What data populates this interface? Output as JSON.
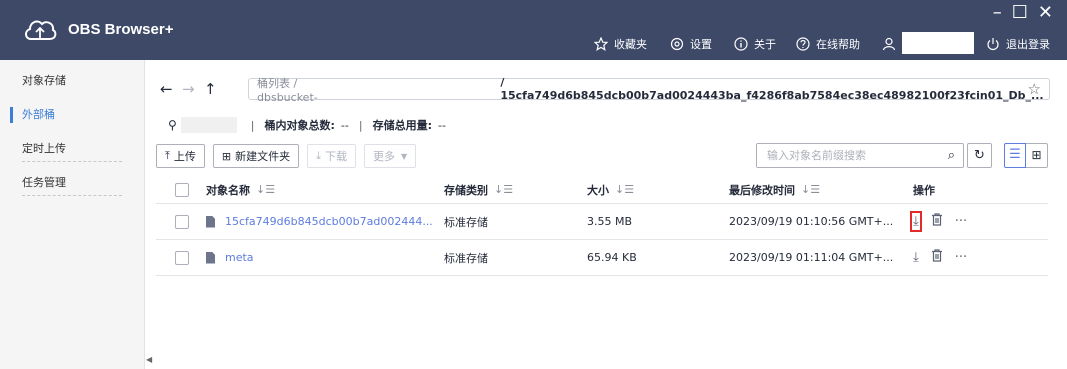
{
  "app": {
    "title": "OBS Browser+"
  },
  "window_controls": {
    "minimize": "–",
    "maximize": "☐",
    "close": "✕"
  },
  "top_menu": {
    "favorites": "收藏夹",
    "settings": "设置",
    "about": "关于",
    "help": "在线帮助",
    "logout": "退出登录"
  },
  "sidebar": {
    "items": [
      {
        "label": "对象存储"
      },
      {
        "label": "外部桶"
      },
      {
        "label": "定时上传"
      },
      {
        "label": "任务管理"
      }
    ]
  },
  "nav": {
    "back": "←",
    "forward": "→",
    "up": "↑",
    "crumb_root": "桶列表 / dbsbucket-",
    "crumb_path": "/ 15cfa749d6b845dcb00b7ad0024443ba_f4286f8ab7584ec38ec48982100f23fcin01_Db_...",
    "favorite_star": "☆"
  },
  "bucket_info": {
    "object_count_label": "桶内对象总数:",
    "object_count_value": "--",
    "storage_label": "存储总用量:",
    "storage_value": "--"
  },
  "toolbar": {
    "upload": "上传",
    "new_folder": "新建文件夹",
    "download": "下载",
    "more": "更多",
    "search_placeholder": "输入对象名前缀搜索"
  },
  "table": {
    "columns": {
      "name": "对象名称",
      "storage_class": "存储类别",
      "size": "大小",
      "modified": "最后修改时间",
      "actions": "操作"
    },
    "rows": [
      {
        "name": "15cfa749d6b845dcb00b7ad002444...",
        "storage_class": "标准存储",
        "size": "3.55 MB",
        "modified": "2023/09/19 01:10:56 GMT+..."
      },
      {
        "name": "meta",
        "storage_class": "标准存储",
        "size": "65.94 KB",
        "modified": "2023/09/19 01:11:04 GMT+..."
      }
    ],
    "action_glyphs": {
      "download": "⤓",
      "delete": "🗑",
      "more": "···"
    }
  },
  "colors": {
    "titlebar": "#3d4967",
    "accent": "#5e7ce0",
    "highlight_box": "#e32a2a"
  }
}
